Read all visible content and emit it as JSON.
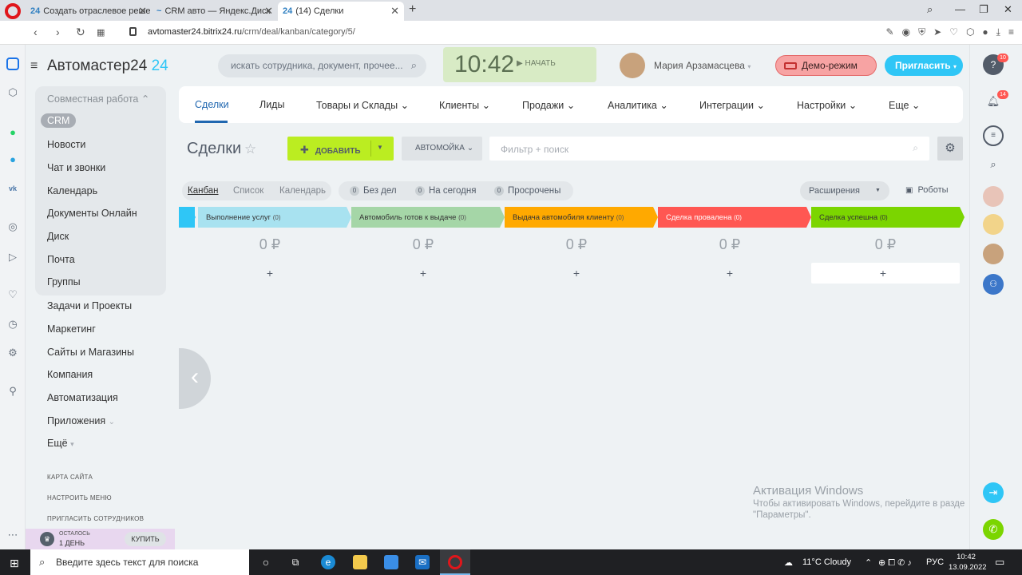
{
  "browser": {
    "tabs": [
      {
        "favicon": "24",
        "title": "Создать отраслевое реше"
      },
      {
        "favicon": "~",
        "title": "CRM авто — Яндекс.Диск"
      },
      {
        "favicon": "24",
        "title": "(14) Сделки"
      }
    ],
    "url_domain": "avtomaster24.bitrix24.ru",
    "url_path": "/crm/deal/kanban/category/5/"
  },
  "portal": {
    "brand_name": "Автомастер24",
    "brand_suffix": "24",
    "search_placeholder": "искать сотрудника, документ, прочее...",
    "clock_time": "10:42",
    "clock_start": "НАЧАТЬ",
    "user_name": "Мария Арзамасцева",
    "demo_label": "Демо-режим",
    "invite_label": "Пригласить"
  },
  "leftmenu": {
    "group_title": "Совместная работа",
    "crm": "CRM",
    "items_group": [
      "Новости",
      "Чат и звонки",
      "Календарь",
      "Документы Онлайн",
      "Диск",
      "Почта",
      "Группы"
    ],
    "items_main": [
      "Задачи и Проекты",
      "Маркетинг",
      "Сайты и Магазины",
      "Компания",
      "Автоматизация",
      "Приложения",
      "Ещё"
    ],
    "small_links": [
      "КАРТА САЙТА",
      "НАСТРОИТЬ МЕНЮ",
      "ПРИГЛАСИТЬ СОТРУДНИКОВ"
    ],
    "trial_left": "ОСТАЛОСЬ",
    "trial_days": "1 ДЕНЬ",
    "buy_label": "КУПИТЬ"
  },
  "navtabs": [
    "Сделки",
    "Лиды",
    "Товары и Склады",
    "Клиенты",
    "Продажи",
    "Аналитика",
    "Интеграции",
    "Настройки",
    "Еще"
  ],
  "deals": {
    "title": "Сделки",
    "add_label": "ДОБАВИТЬ",
    "pipeline_label": "АВТОМОЙКА",
    "filter_placeholder": "Фильтр + поиск"
  },
  "views": [
    "Канбан",
    "Список",
    "Календарь"
  ],
  "counters": [
    {
      "count": "0",
      "label": "Без дел"
    },
    {
      "count": "0",
      "label": "На сегодня"
    },
    {
      "count": "0",
      "label": "Просрочены"
    }
  ],
  "extensions_label": "Расширения",
  "robots_label": "Роботы",
  "stages": [
    {
      "name": "Выполнение услуг",
      "count": "(0)",
      "color": "#a8e2f0",
      "sum": "0 ₽"
    },
    {
      "name": "Автомобиль готов к выдаче",
      "count": "(0)",
      "color": "#a5d6a7",
      "sum": "0 ₽"
    },
    {
      "name": "Выдача автомобиля клиенту",
      "count": "(0)",
      "color": "#ffa900",
      "sum": "0 ₽"
    },
    {
      "name": "Сделка провалена",
      "count": "(0)",
      "color": "#ff5752",
      "sum": "0 ₽"
    },
    {
      "name": "Сделка успешна",
      "count": "(0)",
      "color": "#7bd500",
      "sum": "0 ₽"
    }
  ],
  "add_symbol": "+",
  "activation": {
    "title": "Активация Windows",
    "line1": "Чтобы активировать Windows, перейдите в разде",
    "line2": "\"Параметры\"."
  },
  "rightrail": {
    "badge_top": "10",
    "badge_notif": "14"
  },
  "taskbar": {
    "search_placeholder": "Введите здесь текст для поиска",
    "weather": "11°C  Cloudy",
    "lang": "РУС",
    "time": "10:42",
    "date": "13.09.2022"
  }
}
